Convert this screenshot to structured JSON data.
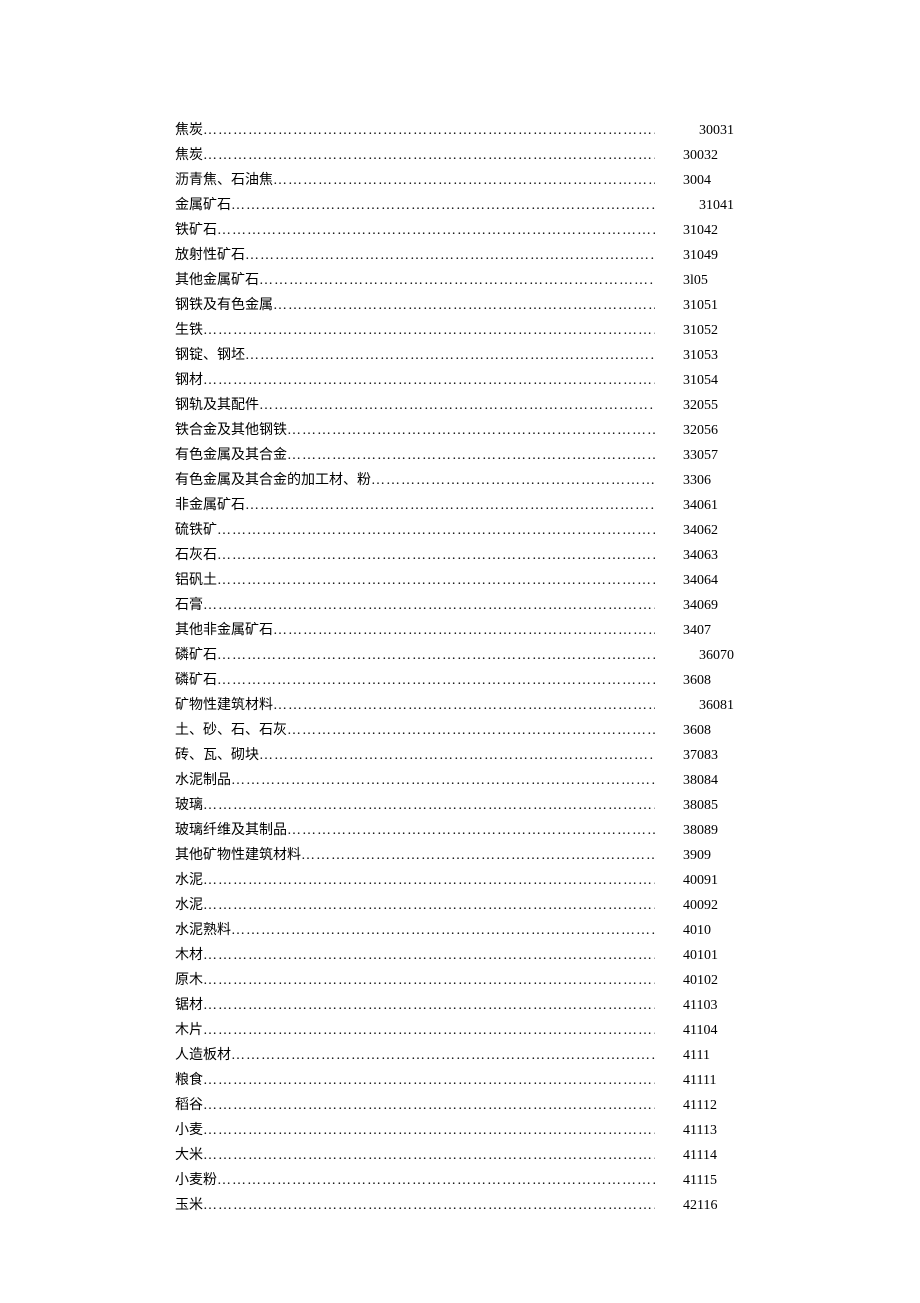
{
  "toc": [
    {
      "label": "焦炭",
      "code": "30031",
      "indent": true
    },
    {
      "label": "焦炭",
      "code": "30032",
      "indent": false
    },
    {
      "label": "沥青焦、石油焦",
      "code": "3004",
      "indent": false
    },
    {
      "label": "金属矿石",
      "code": "31041",
      "indent": true
    },
    {
      "label": "铁矿石",
      "code": "31042",
      "indent": false
    },
    {
      "label": "放射性矿石",
      "code": "31049",
      "indent": false
    },
    {
      "label": "其他金属矿石",
      "code": "3l05",
      "indent": false
    },
    {
      "label": "钢铁及有色金属",
      "code": "31051",
      "indent": false
    },
    {
      "label": "生铁",
      "code": "31052",
      "indent": false
    },
    {
      "label": "钢锭、钢坯",
      "code": "31053",
      "indent": false
    },
    {
      "label": "钢材",
      "code": "31054",
      "indent": false
    },
    {
      "label": "钢轨及其配件",
      "code": "32055",
      "indent": false
    },
    {
      "label": "铁合金及其他钢铁",
      "code": "32056",
      "indent": false
    },
    {
      "label": "有色金属及其合金",
      "code": "33057",
      "indent": false
    },
    {
      "label": "有色金属及其合金的加工材、粉",
      "code": "3306",
      "indent": false
    },
    {
      "label": "非金属矿石",
      "code": "34061",
      "indent": false
    },
    {
      "label": "硫铁矿",
      "code": "34062",
      "indent": false
    },
    {
      "label": "石灰石",
      "code": "34063",
      "indent": false
    },
    {
      "label": "铝矾土",
      "code": "34064",
      "indent": false
    },
    {
      "label": "石膏",
      "code": "34069",
      "indent": false
    },
    {
      "label": "其他非金属矿石",
      "code": "3407",
      "indent": false
    },
    {
      "label": "磷矿石",
      "code": "36070",
      "indent": true
    },
    {
      "label": "磷矿石",
      "code": "3608",
      "indent": false
    },
    {
      "label": "矿物性建筑材料",
      "code": "36081",
      "indent": true
    },
    {
      "label": "土、砂、石、石灰",
      "code": "3608",
      "indent": false
    },
    {
      "label": "砖、瓦、砌块",
      "code": "37083",
      "indent": false
    },
    {
      "label": "水泥制品",
      "code": "38084",
      "indent": false
    },
    {
      "label": "玻璃",
      "code": "38085",
      "indent": false
    },
    {
      "label": "玻璃纤维及其制品",
      "code": "38089",
      "indent": false
    },
    {
      "label": "其他矿物性建筑材料",
      "code": "3909",
      "indent": false
    },
    {
      "label": "水泥",
      "code": "40091",
      "indent": false
    },
    {
      "label": "水泥",
      "code": "40092",
      "indent": false
    },
    {
      "label": "水泥熟料",
      "code": "4010",
      "indent": false
    },
    {
      "label": "木材",
      "code": "40101",
      "indent": false
    },
    {
      "label": "原木",
      "code": "40102",
      "indent": false
    },
    {
      "label": "锯材",
      "code": "41103",
      "indent": false
    },
    {
      "label": "木片",
      "code": "41104",
      "indent": false
    },
    {
      "label": "人造板材",
      "code": "4111",
      "indent": false
    },
    {
      "label": "粮食",
      "code": "41111",
      "indent": false
    },
    {
      "label": "稻谷",
      "code": "41112",
      "indent": false
    },
    {
      "label": "小麦",
      "code": "41113",
      "indent": false
    },
    {
      "label": "大米",
      "code": "41114",
      "indent": false
    },
    {
      "label": "小麦粉",
      "code": "41115",
      "indent": false
    },
    {
      "label": "玉米",
      "code": "42116",
      "indent": false
    }
  ]
}
